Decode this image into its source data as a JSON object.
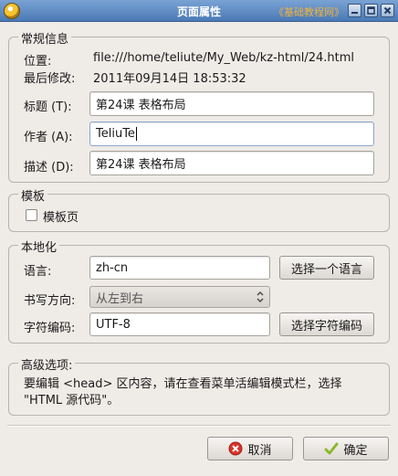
{
  "window": {
    "title": "页面属性",
    "watermark": "《基础教程网》"
  },
  "general": {
    "section_label": "常规信息",
    "location_label": "位置:",
    "location_value": "file:///home/teliute/My_Web/kz-html/24.html",
    "modified_label": "最后修改:",
    "modified_value": "2011年09月14日 18:53:32",
    "title_label": "标题 (T):",
    "title_value": "第24课 表格布局",
    "author_label": "作者 (A):",
    "author_value": "TeliuTe",
    "description_label": "描述 (D):",
    "description_value": "第24课 表格布局"
  },
  "template": {
    "section_label": "模板",
    "checkbox_label": "模板页",
    "checked": false
  },
  "localization": {
    "section_label": "本地化",
    "language_label": "语言:",
    "language_value": "zh-cn",
    "choose_language_button": "选择一个语言",
    "direction_label": "书写方向:",
    "direction_value": "从左到右",
    "charset_label": "字符编码:",
    "charset_value": "UTF-8",
    "choose_charset_button": "选择字符编码"
  },
  "advanced": {
    "section_label": "高级选项:",
    "description_line1": "要编辑 <head> 区内容，请在查看菜单活编辑模式栏，选择",
    "description_line2": "\"HTML 源代码\"。"
  },
  "footer": {
    "cancel_button": "取消",
    "ok_button": "确定"
  },
  "colors": {
    "titlebar": "#5a86bf",
    "watermark": "#f2b23a",
    "cancel_icon": "#d9342b",
    "ok_icon": "#8cb82a"
  }
}
